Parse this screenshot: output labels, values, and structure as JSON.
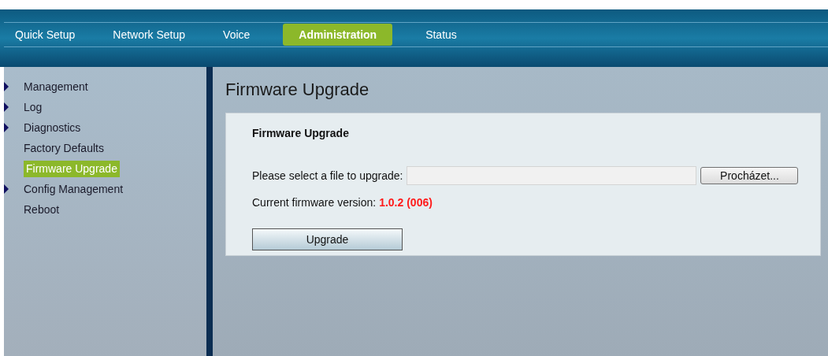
{
  "nav_tabs": [
    {
      "label": "Quick Setup",
      "selected": false
    },
    {
      "label": "Network Setup",
      "selected": false
    },
    {
      "label": "Voice",
      "selected": false
    },
    {
      "label": "Administration",
      "selected": true
    },
    {
      "label": "Status",
      "selected": false
    }
  ],
  "sidebar": {
    "items": [
      {
        "label": "Management",
        "kind": "group",
        "selected": false
      },
      {
        "label": "Log",
        "kind": "group",
        "selected": false
      },
      {
        "label": "Diagnostics",
        "kind": "group",
        "selected": false
      },
      {
        "label": "Factory Defaults",
        "kind": "page",
        "selected": false
      },
      {
        "label": "Firmware Upgrade",
        "kind": "page",
        "selected": true
      },
      {
        "label": "Config Management",
        "kind": "group",
        "selected": false
      },
      {
        "label": "Reboot",
        "kind": "page",
        "selected": false
      }
    ]
  },
  "page_title": "Firmware Upgrade",
  "panel": {
    "title": "Firmware Upgrade",
    "file_label": "Please select a file to upgrade:",
    "browse_button": "Procházet...",
    "version_label": "Current firmware version:",
    "version_value": "1.0.2 (006)",
    "upgrade_button": "Upgrade"
  }
}
